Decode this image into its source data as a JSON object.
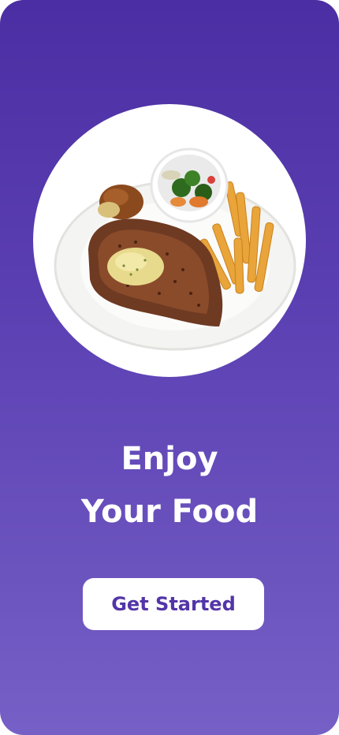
{
  "onboarding": {
    "headline_line1": "Enjoy",
    "headline_line2": "Your Food",
    "cta_label": "Get Started"
  },
  "hero": {
    "image_alt": "Steak with fries, vegetables and sauce on a plate"
  },
  "colors": {
    "background_top": "#4b2ea3",
    "background_bottom": "#7660c6",
    "accent": "#5335a8",
    "button_bg": "#ffffff",
    "text": "#ffffff"
  }
}
